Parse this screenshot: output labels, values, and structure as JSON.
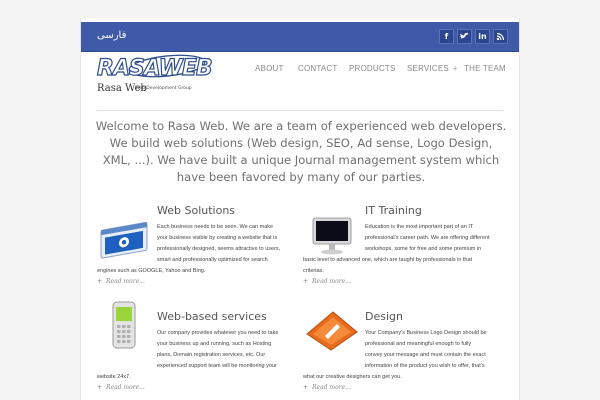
{
  "header": {
    "lang_link": "فارسی",
    "social": [
      {
        "label": "f",
        "icon": "facebook-icon"
      },
      {
        "label": "t",
        "icon": "twitter-icon"
      },
      {
        "label": "in",
        "icon": "linkedin-icon"
      },
      {
        "label": "rss",
        "icon": "rss-icon"
      }
    ]
  },
  "logo": {
    "main": "RASAWEB",
    "sub1": "Rasa Web",
    "sub2": "Web Development Group"
  },
  "nav": {
    "items": [
      "ABOUT",
      "CONTACT",
      "PRODUCTS",
      "SERVICES",
      "THE TEAM"
    ],
    "submenu_marker": "+"
  },
  "intro": "Welcome to Rasa Web. We are a team of experienced web developers. We build web solutions (Web design, SEO, Ad sense, Logo Design, XML, ...). We have built a unique Journal management system which have been favored by many of our parties.",
  "features": [
    {
      "title": "Web Solutions",
      "icon": "browser-window-icon",
      "lines": [
        "Each business needs to be seen. We can make",
        "your business visible by creating a website that is",
        "professionally designed, seems attractive to users,",
        "smart and professionally optimized for search",
        "engines such as GOOGLE, Yahoo and Bing."
      ],
      "readmore": "Read more..."
    },
    {
      "title": "IT Training",
      "icon": "monitor-icon",
      "lines": [
        "Education is the most important part of an IT",
        "professional's career path. We are offering different",
        "workshops, some for free and some premium in",
        "basic level to advanced one, which are taught by professionals in that",
        "criterias."
      ],
      "readmore": "Read more..."
    },
    {
      "title": "Web-based services",
      "icon": "mobile-phone-icon",
      "lines": [
        "Our company provides whatever you need to take",
        "your business up and running, such as Hosting",
        "plans, Domain registration services, etc. Our",
        "experienced support team will be monitoring your",
        "website 24x7."
      ],
      "readmore": "Read more..."
    },
    {
      "title": "Design",
      "icon": "design-sign-icon",
      "lines": [
        "Your Company's Business Logo Design should be",
        "professional and meaningful enough to fully",
        "convey your message and must contain the exact",
        "information of the product you wish to offer, that's",
        "what our creative designers can get you."
      ],
      "readmore": "Read more..."
    }
  ],
  "colors": {
    "topbar": "#3e5aa8",
    "logo_blue": "#2d4d8c"
  }
}
